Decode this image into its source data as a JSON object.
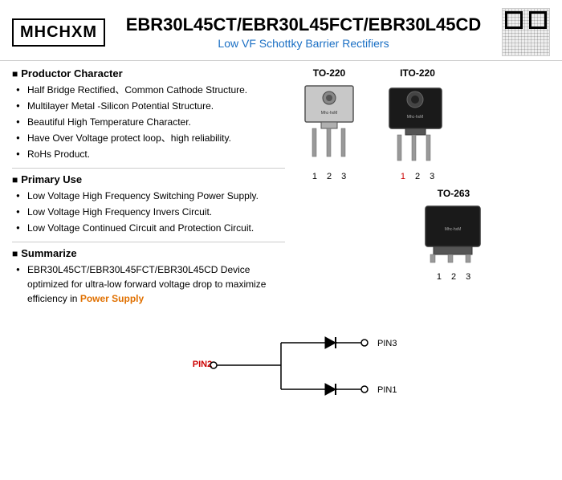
{
  "header": {
    "logo": "MHCHXM",
    "title": "EBR30L45CT/EBR30L45FCT/EBR30L45CD",
    "subtitle": "Low VF Schottky Barrier Rectifiers"
  },
  "product_character": {
    "section_title": "Productor Character",
    "bullets": [
      "Half Bridge Rectified、Common Cathode Structure.",
      "Multilayer Metal -Silicon Potential Structure.",
      "Beautiful High Temperature Character.",
      "Have Over Voltage protect loop、high  reliability.",
      "RoHs Product."
    ]
  },
  "primary_use": {
    "section_title": "Primary Use",
    "bullets": [
      "Low Voltage High Frequency Switching Power Supply.",
      "Low Voltage High Frequency  Invers Circuit.",
      "Low Voltage Continued  Circuit and Protection Circuit."
    ]
  },
  "summarize": {
    "section_title": "Summarize",
    "text_before": "EBR30L45CT/EBR30L45FCT/EBR30L45CD Device optimized for ultra-low forward voltage drop to maximize efficiency in ",
    "highlight": "Power Supply",
    "text_after": ""
  },
  "packages": {
    "to220": {
      "label": "TO-220",
      "pins": [
        "1",
        "2",
        "3"
      ]
    },
    "ito220": {
      "label": "ITO-220",
      "pins": [
        "1",
        "2",
        "3"
      ]
    },
    "to263": {
      "label": "TO-263",
      "pins": [
        "1",
        "2",
        "3"
      ]
    }
  },
  "circuit": {
    "pin1_label": "PIN1",
    "pin2_label": "PIN2",
    "pin3_label": "PIN3"
  }
}
